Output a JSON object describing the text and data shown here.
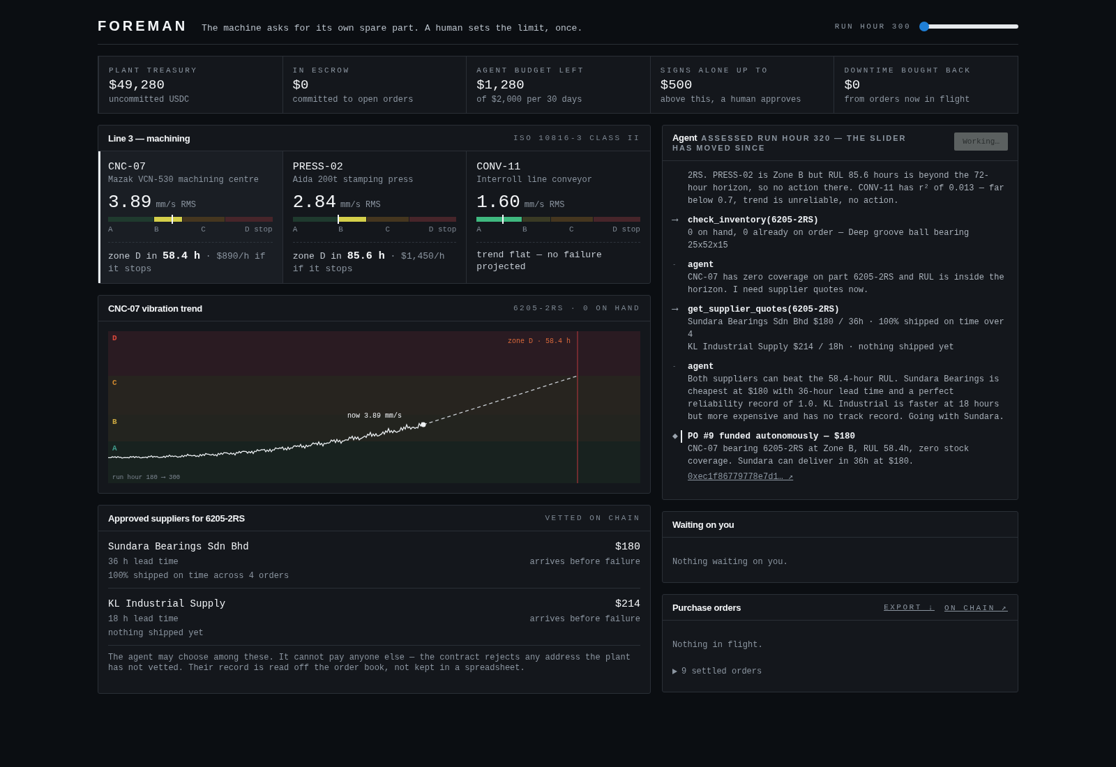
{
  "header": {
    "logo": "FOREMAN",
    "tagline": "The machine asks for its own spare part. A human sets the limit, once.",
    "run_hour": {
      "label": "RUN HOUR 300",
      "level": 0
    }
  },
  "stats": [
    {
      "label": "PLANT TREASURY",
      "value": "$49,280",
      "note": "uncommitted USDC"
    },
    {
      "label": "IN ESCROW",
      "value": "$0",
      "note": "committed to open orders"
    },
    {
      "label": "AGENT BUDGET LEFT",
      "value": "$1,280",
      "note": "of $2,000 per 30 days"
    },
    {
      "label": "SIGNS ALONE UP TO",
      "value": "$500",
      "note": "above this, a human approves"
    },
    {
      "label": "DOWNTIME BOUGHT BACK",
      "value": "$0",
      "note": "from orders now in flight"
    }
  ],
  "line": {
    "title": "Line 3 — machining",
    "standard": "ISO 10816-3 CLASS II",
    "machines": [
      {
        "name": "CNC-07",
        "model": "Mazak VCN-530 machining centre",
        "reading": "3.89",
        "unit": "mm/s RMS",
        "selected": true,
        "meter": {
          "level": 0.39,
          "zones": [
            {
              "label": "A",
              "active": false
            },
            {
              "label": "B",
              "active": true
            },
            {
              "label": "C",
              "active": false
            },
            {
              "label": "D stop",
              "active": false
            }
          ]
        },
        "forecast": {
          "kind": "failure",
          "prefix": "zone D in",
          "hours": "58.4 h",
          "suffix": "· $890/h if it stops"
        }
      },
      {
        "name": "PRESS-02",
        "model": "Aida 200t stamping press",
        "reading": "2.84",
        "unit": "mm/s RMS",
        "selected": false,
        "meter": {
          "level": 0.28,
          "zones": [
            {
              "label": "A",
              "active": false
            },
            {
              "label": "B",
              "active": true
            },
            {
              "label": "C",
              "active": false
            },
            {
              "label": "D stop",
              "active": false
            }
          ]
        },
        "forecast": {
          "kind": "failure",
          "prefix": "zone D in",
          "hours": "85.6 h",
          "suffix": "· $1,450/h if it stops"
        }
      },
      {
        "name": "CONV-11",
        "model": "Interroll line conveyor",
        "reading": "1.60",
        "unit": "mm/s RMS",
        "selected": false,
        "meter": {
          "level": 0.16,
          "zones": [
            {
              "label": "A",
              "active": true
            },
            {
              "label": "B",
              "active": false
            },
            {
              "label": "C",
              "active": false
            },
            {
              "label": "D stop",
              "active": false
            }
          ]
        },
        "forecast": {
          "kind": "flat",
          "text": "trend flat — no failure projected"
        }
      }
    ]
  },
  "trend": {
    "title": "CNC-07 vibration trend",
    "meta": "6205-2RS · 0 ON HAND",
    "zones": [
      {
        "label": "D",
        "color": "#d9483b"
      },
      {
        "label": "C",
        "color": "#d0892f"
      },
      {
        "label": "B",
        "color": "#c9a640"
      },
      {
        "label": "A",
        "color": "#3f9a8a"
      }
    ],
    "threshold_label": "zone D · 58.4 h",
    "now_label": "now 3.89 mm/s",
    "range_label": "run hour 180 ⟶ 300"
  },
  "suppliers": {
    "title": "Approved suppliers for 6205-2RS",
    "meta": "VETTED ON CHAIN",
    "items": [
      {
        "name": "Sundara Bearings Sdn Bhd",
        "price": "$180",
        "lead": "36 h lead time",
        "verdict": "arrives before failure",
        "record": "100% shipped on time across 4 orders"
      },
      {
        "name": "KL Industrial Supply",
        "price": "$214",
        "lead": "18 h lead time",
        "verdict": "arrives before failure",
        "record": "nothing shipped yet"
      }
    ],
    "footnote": "The agent may choose among these. It cannot pay anyone else — the contract rejects any address the plant has not vetted. Their record is read off the order book, not kept in a spreadsheet."
  },
  "agent": {
    "title": "Agent",
    "status": "ASSESSED RUN HOUR 320 — THE SLIDER HAS MOVED SINCE",
    "button": {
      "label": "Working…",
      "disabled": true
    },
    "entries": [
      {
        "kind": "text",
        "lines": [
          "2RS. PRESS-02 is Zone B but RUL 85.6 hours is beyond the 72-hour horizon, so no action there. CONV-11 has r² of 0.013 — far below 0.7, trend is unreliable, no action."
        ]
      },
      {
        "kind": "tool",
        "marker": "⟶",
        "head": "check_inventory(6205-2RS)",
        "lines": [
          "0 on hand, 0 already on order — Deep groove ball bearing 25x52x15"
        ]
      },
      {
        "kind": "agent",
        "marker": "-",
        "head": "agent",
        "lines": [
          "CNC-07 has zero coverage on part 6205-2RS and RUL is inside the horizon. I need supplier quotes now."
        ]
      },
      {
        "kind": "tool",
        "marker": "⟶",
        "head": "get_supplier_quotes(6205-2RS)",
        "lines": [
          "Sundara Bearings Sdn Bhd $180 / 36h · 100% shipped on time over 4",
          "KL Industrial Supply $214 / 18h · nothing shipped yet"
        ]
      },
      {
        "kind": "agent",
        "marker": "-",
        "head": "agent",
        "lines": [
          "Both suppliers can beat the 58.4-hour RUL. Sundara Bearings is cheapest at $180 with 36-hour lead time and a perfect reliability record of 1.0. KL Industrial is faster at 18 hours but more expensive and has no track record. Going with Sundara."
        ]
      },
      {
        "kind": "result",
        "marker": "◆",
        "head": "PO #9 funded autonomously — $180",
        "lines": [
          "CNC-07 bearing 6205-2RS at Zone B, RUL 58.4h, zero stock coverage. Sundara can deliver in 36h at $180."
        ],
        "link": "0xec1f86779778e7d1… ↗"
      }
    ]
  },
  "waiting": {
    "title": "Waiting on you",
    "empty": "Nothing waiting on you."
  },
  "orders": {
    "title": "Purchase orders",
    "links": [
      "EXPORT ↓",
      "ON CHAIN ↗"
    ],
    "empty": "Nothing in flight.",
    "settled": {
      "label": "9 settled orders",
      "expanded": false
    }
  }
}
